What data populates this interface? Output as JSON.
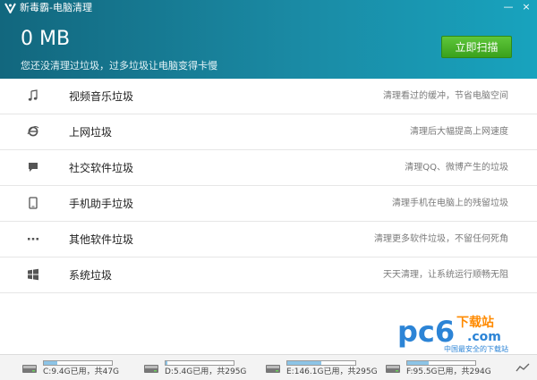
{
  "window": {
    "title": "新毒霸-电脑清理",
    "controls": [
      "—",
      "×"
    ]
  },
  "header": {
    "size": "0 MB",
    "subtitle": "您还没清理过垃圾，过多垃圾让电脑变得卡慢",
    "scan_button": "立即扫描"
  },
  "items": [
    {
      "label": "视频音乐垃圾",
      "desc": "清理看过的缓冲，节省电脑空间",
      "icon": "music-note-icon"
    },
    {
      "label": "上网垃圾",
      "desc": "清理后大幅提高上网速度",
      "icon": "ie-browser-icon"
    },
    {
      "label": "社交软件垃圾",
      "desc": "清理QQ、微博产生的垃圾",
      "icon": "chat-bubble-icon"
    },
    {
      "label": "手机助手垃圾",
      "desc": "清理手机在电脑上的残留垃圾",
      "icon": "tablet-icon"
    },
    {
      "label": "其他软件垃圾",
      "desc": "清理更多软件垃圾，不留任何死角",
      "icon": "more-dots-icon"
    },
    {
      "label": "系统垃圾",
      "desc": "天天清理，让系统运行顺畅无阻",
      "icon": "windows-icon"
    }
  ],
  "drives": [
    {
      "text": "C:9.4G已用，共47G",
      "used_fraction": 0.2
    },
    {
      "text": "D:5.4G已用，共295G",
      "used_fraction": 0.02
    },
    {
      "text": "E:146.1G已用，共295G",
      "used_fraction": 0.5
    },
    {
      "text": "F:95.5G已用，共294G",
      "used_fraction": 0.32
    }
  ],
  "watermark": {
    "brand": "pc6",
    "site": "下载站",
    "domain": ".com",
    "slogan": "中国最安全的下载站"
  },
  "colors": {
    "header_start": "#12677e",
    "header_end": "#18a3be",
    "scan_button": "#4cb52a",
    "drive_fill": "#8cc4e6"
  }
}
